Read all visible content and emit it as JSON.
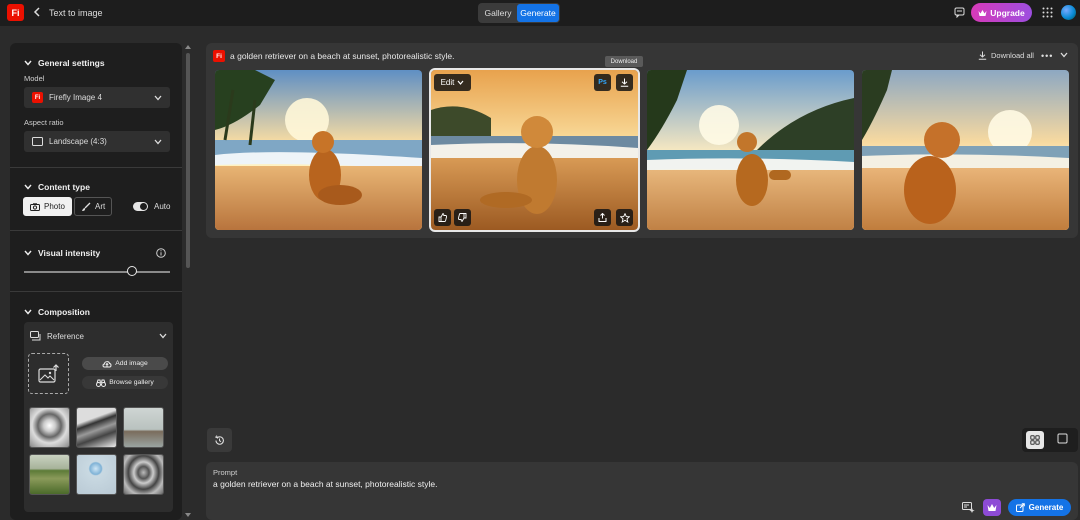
{
  "app": {
    "logo": "Fi",
    "breadcrumb": "Text to image"
  },
  "header": {
    "tabs": [
      {
        "label": "Gallery"
      },
      {
        "label": "Generate"
      }
    ],
    "upgrade_label": "Upgrade"
  },
  "sidebar": {
    "general_settings": "General settings",
    "model_label": "Model",
    "model_value": "Firefly Image 4",
    "aspect_label": "Aspect ratio",
    "aspect_value": "Landscape (4:3)",
    "content_type": "Content type",
    "photo": "Photo",
    "art": "Art",
    "auto": "Auto",
    "visual_intensity": "Visual intensity",
    "visual_intensity_level": 0.74,
    "composition": "Composition",
    "reference": "Reference",
    "add_image": "Add image",
    "browse_gallery": "Browse gallery"
  },
  "results": {
    "prompt_text": "a golden retriever on a beach at sunset, photorealistic style.",
    "download_all": "Download all",
    "more": "•••",
    "edit_label": "Edit",
    "ps_label": "Ps",
    "tooltip": "Download"
  },
  "prompt_box": {
    "label": "Prompt",
    "value": "a golden retriever on a beach at sunset, photorealistic style.",
    "generate_label": "Generate"
  },
  "colors": {
    "accent": "#1473e6",
    "brand": "#eb1000",
    "upgrade": "#c84bd6"
  }
}
